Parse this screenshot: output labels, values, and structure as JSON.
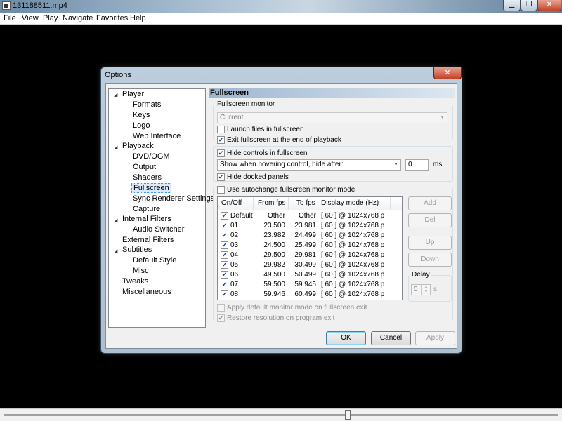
{
  "window": {
    "title": "131188511.mp4",
    "min_symbol": "▁",
    "max_symbol": "❐",
    "close_symbol": "✕"
  },
  "menu": [
    "File",
    "View",
    "Play",
    "Navigate",
    "Favorites",
    "Help"
  ],
  "dialog": {
    "title": "Options",
    "close_symbol": "✕",
    "tree": [
      {
        "label": "Player",
        "level": 0,
        "expanded": true
      },
      {
        "label": "Formats",
        "level": 1
      },
      {
        "label": "Keys",
        "level": 1
      },
      {
        "label": "Logo",
        "level": 1
      },
      {
        "label": "Web Interface",
        "level": 1
      },
      {
        "label": "Playback",
        "level": 0,
        "expanded": true
      },
      {
        "label": "DVD/OGM",
        "level": 1
      },
      {
        "label": "Output",
        "level": 1
      },
      {
        "label": "Shaders",
        "level": 1
      },
      {
        "label": "Fullscreen",
        "level": 1,
        "selected": true
      },
      {
        "label": "Sync Renderer Settings",
        "level": 1
      },
      {
        "label": "Capture",
        "level": 1
      },
      {
        "label": "Internal Filters",
        "level": 0,
        "expanded": true
      },
      {
        "label": "Audio Switcher",
        "level": 1
      },
      {
        "label": "External Filters",
        "level": 0
      },
      {
        "label": "Subtitles",
        "level": 0,
        "expanded": true
      },
      {
        "label": "Default Style",
        "level": 1
      },
      {
        "label": "Misc",
        "level": 1
      },
      {
        "label": "Tweaks",
        "level": 0
      },
      {
        "label": "Miscellaneous",
        "level": 0
      }
    ],
    "panel": {
      "header": "Fullscreen",
      "monitor_group_label": "Fullscreen monitor",
      "monitor_value": "Current",
      "launch_fullscreen": {
        "label": "Launch files in fullscreen",
        "checked": false
      },
      "exit_fullscreen": {
        "label": "Exit fullscreen at the end of playback",
        "checked": true
      },
      "hide_controls": {
        "label": "Hide controls in fullscreen",
        "checked": true
      },
      "hide_mode_value": "Show when hovering control, hide after:",
      "hide_delay_value": "0",
      "hide_delay_unit": "ms",
      "hide_docked": {
        "label": "Hide docked panels",
        "checked": true
      },
      "autochange": {
        "label": "Use autochange fullscreen monitor mode",
        "checked": false
      },
      "columns": [
        "On/Off",
        "From fps",
        "To fps",
        "Display mode (Hz)"
      ],
      "rows": [
        {
          "name": "Default",
          "from": "Other",
          "to": "Other",
          "mode": "[ 60 ]  @ 1024x768 p",
          "checked": true
        },
        {
          "name": "01",
          "from": "23.500",
          "to": "23.981",
          "mode": "[ 60 ]  @ 1024x768 p",
          "checked": true
        },
        {
          "name": "02",
          "from": "23.982",
          "to": "24.499",
          "mode": "[ 60 ]  @ 1024x768 p",
          "checked": true
        },
        {
          "name": "03",
          "from": "24.500",
          "to": "25.499",
          "mode": "[ 60 ]  @ 1024x768 p",
          "checked": true
        },
        {
          "name": "04",
          "from": "29.500",
          "to": "29.981",
          "mode": "[ 60 ]  @ 1024x768 p",
          "checked": true
        },
        {
          "name": "05",
          "from": "29.982",
          "to": "30.499",
          "mode": "[ 60 ]  @ 1024x768 p",
          "checked": true
        },
        {
          "name": "06",
          "from": "49.500",
          "to": "50.499",
          "mode": "[ 60 ]  @ 1024x768 p",
          "checked": true
        },
        {
          "name": "07",
          "from": "59.500",
          "to": "59.945",
          "mode": "[ 60 ]  @ 1024x768 p",
          "checked": true
        },
        {
          "name": "08",
          "from": "59.946",
          "to": "60.499",
          "mode": "[ 60 ]  @ 1024x768 p",
          "checked": true
        }
      ],
      "side_buttons": {
        "add": "Add",
        "del": "Del",
        "up": "Up",
        "down": "Down"
      },
      "delay_label": "Delay",
      "delay_value": "0",
      "delay_unit": "s",
      "apply_default_mode": {
        "label": "Apply default monitor mode on fullscreen exit",
        "checked": false
      },
      "restore_resolution": {
        "label": "Restore resolution on program exit",
        "checked": true
      }
    },
    "buttons": {
      "ok": "OK",
      "cancel": "Cancel",
      "apply": "Apply"
    }
  },
  "seek": {
    "thumb_symbol": "⇕",
    "position": 0.62
  }
}
